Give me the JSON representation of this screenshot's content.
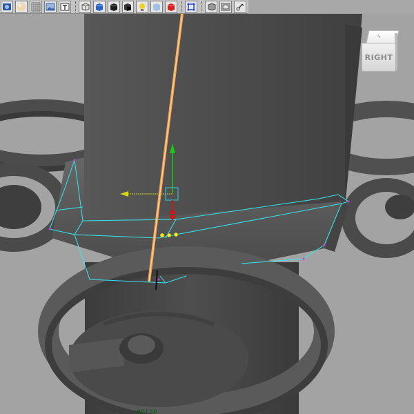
{
  "toolbar": {
    "buttons": [
      {
        "name": "select-camera-icon",
        "color": "#2b58a8"
      },
      {
        "name": "lighting-sphere-icon",
        "color": "#e8c89a"
      },
      {
        "name": "grid-toggle-icon",
        "color": "#555555"
      },
      {
        "name": "image-plane-icon",
        "color": "#3a5fa0"
      },
      {
        "name": "texture-text-icon",
        "color": "#333333"
      },
      {
        "name": "wireframe-cube-icon",
        "color": "#555555"
      },
      {
        "name": "smooth-shade-cube-icon",
        "color": "#2a63c8"
      },
      {
        "name": "flat-shade-cube-icon",
        "color": "#1c1c1c"
      },
      {
        "name": "shadow-cube-icon",
        "color": "#333333"
      },
      {
        "name": "use-lights-bulb-icon",
        "color": "#f0d020"
      },
      {
        "name": "xray-cube-icon",
        "color": "#8fb8e0"
      },
      {
        "name": "isolate-red-cube-icon",
        "color": "#d42020"
      },
      {
        "name": "frame-selection-icon",
        "color": "#2040c8"
      },
      {
        "name": "backface-cube-icon",
        "color": "#444444"
      },
      {
        "name": "resolution-gate-icon",
        "color": "#444444"
      },
      {
        "name": "joint-xray-icon",
        "color": "#333333"
      }
    ]
  },
  "viewport": {
    "viewcube_label": "RIGHT",
    "camera_label": "persp",
    "colors": {
      "background": "#a3a3a3",
      "mesh_dark": "#3a3a3a",
      "mesh_mid": "#565656",
      "mesh_light": "#6e6e6e",
      "selection_wire": "#35e6f0",
      "vertex_purple": "#c040e0",
      "highlight_vertex": "#f0f020",
      "manip_y": "#18c818",
      "manip_x": "#d8d818",
      "manip_z": "#c81818",
      "beam": "#f0a050"
    }
  }
}
